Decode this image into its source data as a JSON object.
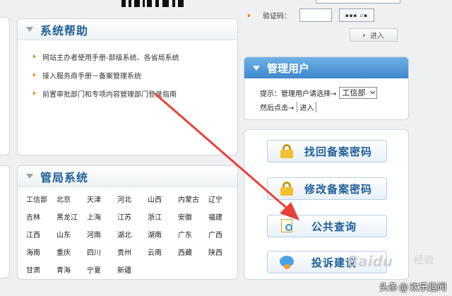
{
  "help": {
    "title": "系统帮助",
    "items": [
      "网站主办者使用手册-部级系统、各省局系统",
      "接入服务商手册－备案管理系统",
      "前置审批部门和专项内容管理部门登录指南"
    ]
  },
  "gov": {
    "title": "管局系统",
    "provinces": [
      "工信部",
      "北京",
      "天津",
      "河北",
      "山西",
      "内蒙古",
      "辽宁",
      "吉林",
      "黑龙江",
      "上海",
      "江苏",
      "浙江",
      "安徽",
      "福建",
      "江西",
      "山东",
      "河南",
      "湖北",
      "湖南",
      "广东",
      "广西",
      "海南",
      "重庆",
      "四川",
      "贵州",
      "云南",
      "西藏",
      "陕西",
      "甘肃",
      "青海",
      "宁夏",
      "新疆"
    ]
  },
  "login": {
    "captcha_label": "验证码：",
    "enter_label": "进入"
  },
  "admin": {
    "title": "管理用户",
    "prompt": "提示：管理用户请选择→",
    "dept_selected": "工信部",
    "then_click": "然后点击→",
    "enter_label": "进入"
  },
  "services": {
    "recover": "找回备案密码",
    "modify": "修改备案密码",
    "query": "公共查询",
    "complain": "投诉建议"
  },
  "watermark": {
    "brand": "Baidu",
    "brand_cn": "经验",
    "credit_prefix": "头条",
    "credit_at": "@",
    "credit_name": "欢乐趣闻"
  },
  "colors": {
    "title_blue": "#1f5f9a",
    "admin_head": "#3f88cc",
    "bullet_orange": "#f08a24",
    "annotation_red": "#e8403a"
  }
}
